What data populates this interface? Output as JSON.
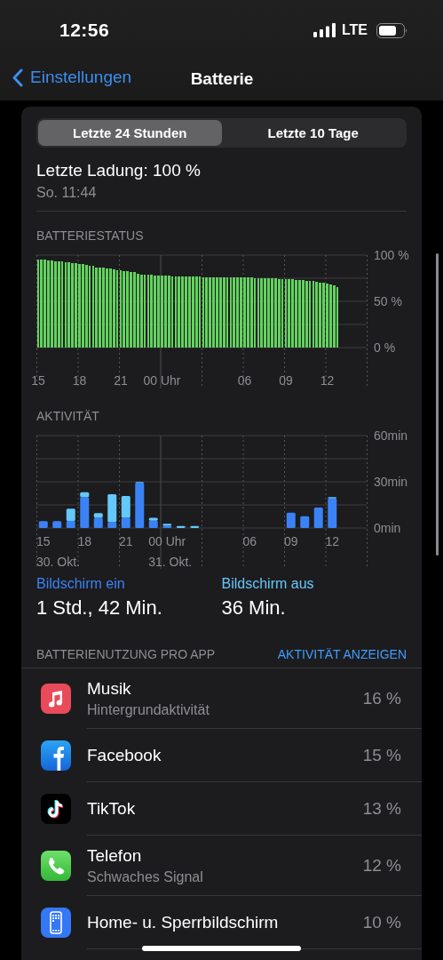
{
  "status_bar": {
    "time": "12:56",
    "network": "LTE"
  },
  "nav": {
    "back": "Einstellungen",
    "title": "Batterie"
  },
  "segments": [
    {
      "label": "Letzte 24 Stunden",
      "selected": true
    },
    {
      "label": "Letzte 10 Tage",
      "selected": false
    }
  ],
  "last_charge": {
    "title": "Letzte Ladung: 100 %",
    "time": "So. 11:44"
  },
  "battery_status": {
    "heading": "BATTERIESTATUS",
    "chart_data": {
      "type": "bar",
      "ylim": [
        0,
        100
      ],
      "categories": [
        "15",
        null,
        null,
        null,
        null,
        null,
        null,
        null,
        null,
        null,
        null,
        null,
        "18",
        null,
        null,
        null,
        null,
        null,
        null,
        null,
        null,
        null,
        null,
        null,
        "21",
        null,
        null,
        null,
        null,
        null,
        null,
        null,
        null,
        null,
        null,
        null,
        "00 Uhr",
        null,
        null,
        null,
        null,
        null,
        null,
        null,
        null,
        null,
        null,
        null,
        null,
        null,
        null,
        null,
        null,
        null,
        null,
        null,
        null,
        null,
        null,
        null,
        "06",
        null,
        null,
        null,
        null,
        null,
        null,
        null,
        null,
        null,
        null,
        null,
        "09",
        null,
        null,
        null,
        null,
        null,
        null,
        null,
        null,
        null,
        null,
        null,
        "12",
        null,
        null,
        null,
        null,
        null,
        null,
        null,
        null,
        null,
        null,
        null
      ],
      "series": [
        {
          "color": "#63d25f",
          "values": [
            95,
            95,
            95,
            94,
            94,
            93,
            93,
            93,
            92,
            92,
            91,
            91,
            90,
            90,
            89,
            88,
            88,
            87,
            87,
            87,
            86,
            86,
            85,
            84,
            84,
            83,
            83,
            82,
            82,
            80,
            79,
            79,
            79,
            79,
            78,
            78,
            78,
            78,
            78,
            77,
            77,
            77,
            77,
            77,
            77,
            77,
            77,
            77,
            76,
            76,
            76,
            76,
            76,
            76,
            76,
            76,
            76,
            76,
            76,
            76,
            76,
            76,
            76,
            75,
            75,
            75,
            75,
            75,
            75,
            75,
            74,
            74,
            74,
            74,
            74,
            73,
            73,
            73,
            72,
            72,
            72,
            71,
            70,
            70,
            69,
            68,
            67,
            65,
            null,
            null,
            null,
            null,
            null,
            null,
            null,
            null
          ]
        }
      ],
      "yticks": [
        {
          "value": 0,
          "label": "0 %"
        },
        {
          "value": 50,
          "label": "50 %"
        },
        {
          "value": 100,
          "label": "100 %"
        }
      ]
    }
  },
  "activity": {
    "heading": "AKTIVITÄT",
    "chart_data": {
      "type": "bar",
      "stacked": true,
      "ylim": [
        0,
        60
      ],
      "categories": [
        "15",
        null,
        null,
        "18",
        null,
        null,
        "21",
        null,
        null,
        "00 Uhr",
        null,
        null,
        null,
        null,
        null,
        "06",
        null,
        null,
        "09",
        null,
        null,
        "12",
        null,
        null
      ],
      "series": [
        {
          "name": "Bildschirm ein",
          "color": "#3a82f6",
          "values": [
            4.5,
            4.5,
            4.6,
            20,
            6.6,
            3.7,
            6.6,
            29.4,
            4.8,
            1.5,
            0,
            0,
            null,
            null,
            null,
            null,
            null,
            null,
            9.9,
            7.7,
            13.2,
            19.2,
            null,
            null
          ]
        },
        {
          "name": "Bildschirm aus",
          "color": "#64c8fa",
          "values": [
            0,
            0,
            8,
            3.2,
            3.1,
            18.2,
            14.1,
            0.5,
            1.8,
            1.2,
            1.3,
            1.3,
            null,
            null,
            null,
            null,
            null,
            null,
            0,
            0,
            0,
            0.9,
            null,
            null
          ]
        }
      ],
      "yticks": [
        {
          "value": 0,
          "label": "0min"
        },
        {
          "value": 30,
          "label": "30min"
        },
        {
          "value": 60,
          "label": "60min"
        }
      ],
      "annotations": [
        "30. Okt.",
        "31. Okt."
      ]
    }
  },
  "screen_time": [
    "1 Std., 42 Min.",
    "36 Min."
  ],
  "usage": {
    "heading": "BATTERIENUTZUNG PRO APP",
    "link": "AKTIVITÄT ANZEIGEN",
    "apps": [
      {
        "kind": "music",
        "name": "Musik",
        "detail": "Hintergrundaktivität",
        "percent": "16 %"
      },
      {
        "kind": "facebook",
        "name": "Facebook",
        "percent": "15 %"
      },
      {
        "kind": "tiktok",
        "name": "TikTok",
        "percent": "13 %"
      },
      {
        "kind": "phone",
        "name": "Telefon",
        "detail": "Schwaches Signal",
        "percent": "12 %"
      },
      {
        "kind": "homescreen",
        "name": "Home- u. Sperrbildschirm",
        "percent": "10 %"
      }
    ]
  }
}
